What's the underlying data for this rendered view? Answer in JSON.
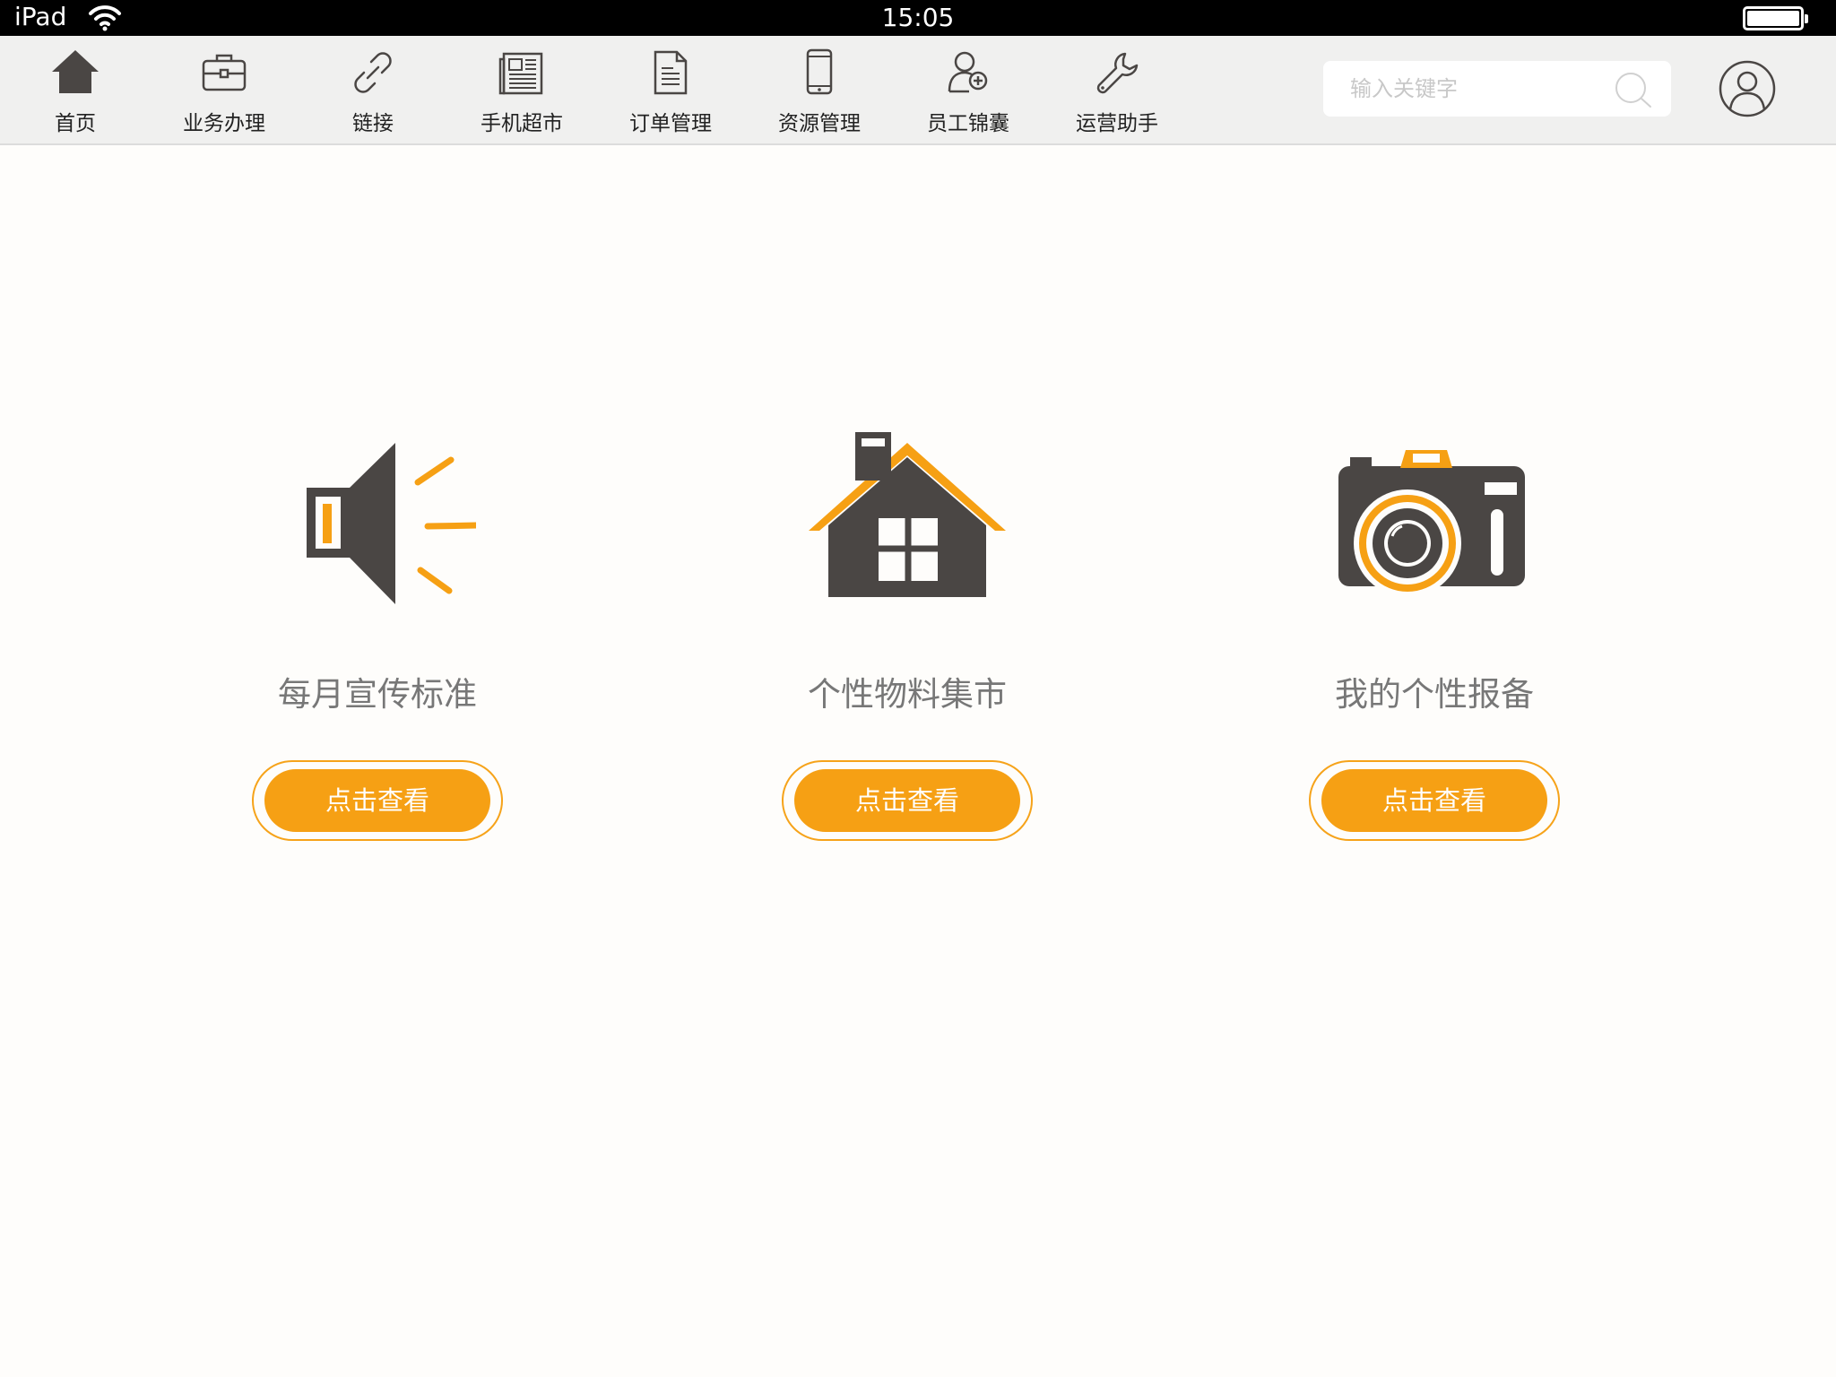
{
  "status_bar": {
    "device": "iPad",
    "time": "15:05"
  },
  "nav": {
    "items": [
      {
        "label": "首页",
        "icon": "home-icon"
      },
      {
        "label": "业务办理",
        "icon": "briefcase-icon"
      },
      {
        "label": "链接",
        "icon": "link-icon"
      },
      {
        "label": "手机超市",
        "icon": "newspaper-icon"
      },
      {
        "label": "订单管理",
        "icon": "document-icon"
      },
      {
        "label": "资源管理",
        "icon": "phone-icon"
      },
      {
        "label": "员工锦囊",
        "icon": "user-add-icon"
      },
      {
        "label": "运营助手",
        "icon": "wrench-icon"
      }
    ],
    "search": {
      "placeholder": "输入关键字",
      "value": ""
    },
    "avatar_icon": "user-avatar-icon"
  },
  "cards": [
    {
      "title": "每月宣传标准",
      "button_label": "点击查看",
      "icon": "megaphone-icon"
    },
    {
      "title": "个性物料集市",
      "button_label": "点击查看",
      "icon": "house-icon"
    },
    {
      "title": "我的个性报备",
      "button_label": "点击查看",
      "icon": "camera-icon"
    }
  ],
  "colors": {
    "accent": "#f6a014",
    "icon_dark": "#4a4644",
    "nav_bg": "#f0f0ef",
    "page_bg": "#fefdfb"
  }
}
